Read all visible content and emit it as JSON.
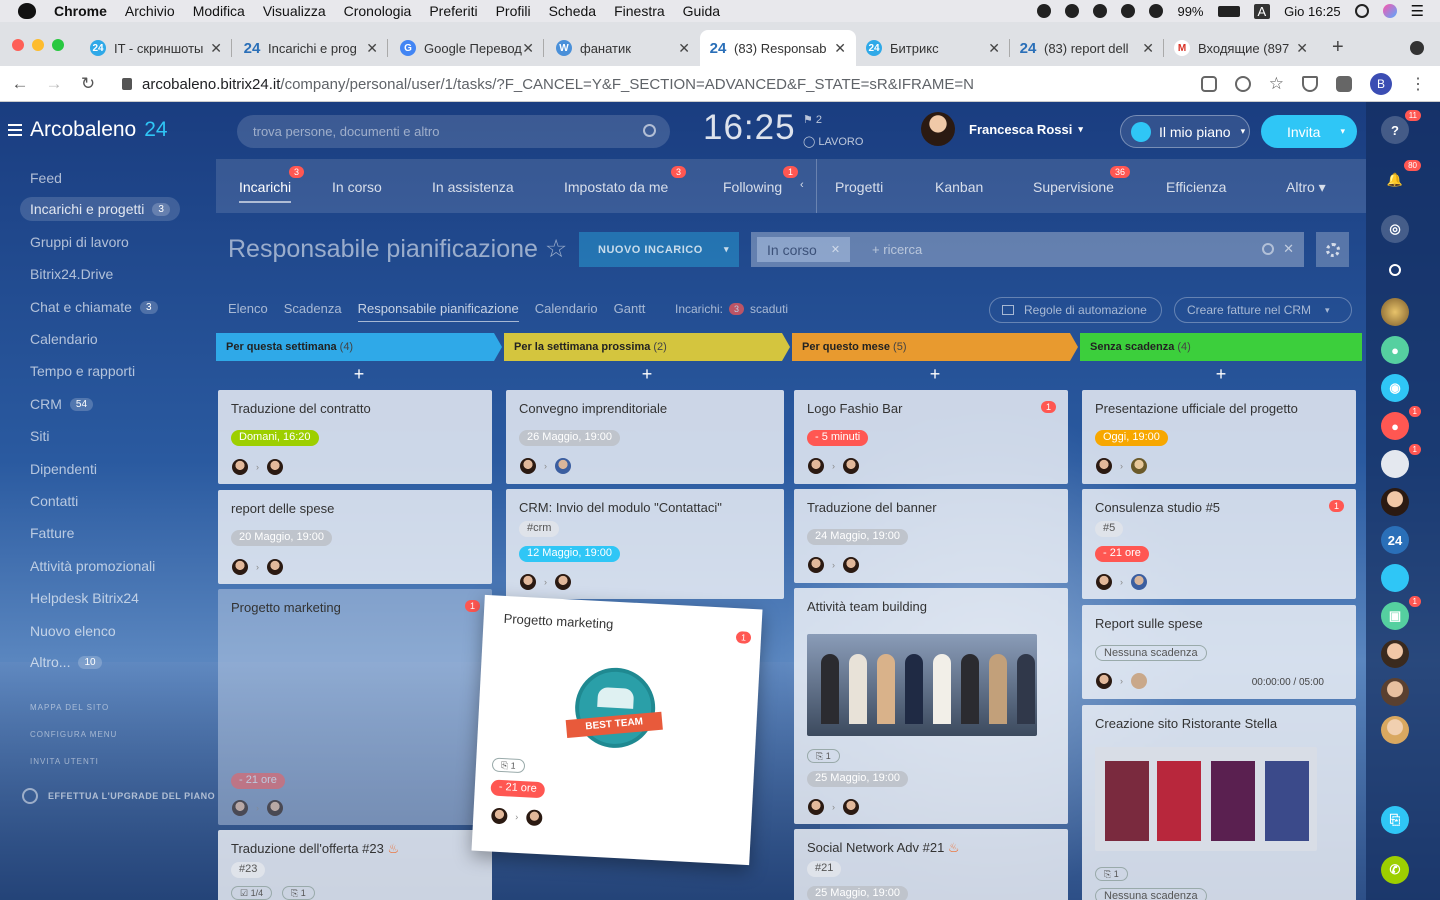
{
  "mac_menu": {
    "app": "Chrome",
    "items": [
      "Archivio",
      "Modifica",
      "Visualizza",
      "Cronologia",
      "Preferiti",
      "Profili",
      "Scheda",
      "Finestra",
      "Guida"
    ],
    "battery": "99%",
    "input_letter": "A",
    "datetime": "Gio 16:25"
  },
  "browser_tabs": [
    {
      "title": "IT - скриншоты",
      "favicon": "24"
    },
    {
      "title": "Incarichi e prog",
      "favicon": "24"
    },
    {
      "title": "Google Перевод",
      "favicon": "G"
    },
    {
      "title": "фанатик",
      "favicon": "W"
    },
    {
      "title": "(83) Responsab",
      "favicon": "24",
      "active": true
    },
    {
      "title": "Битрикс",
      "favicon": "24"
    },
    {
      "title": "(83) report dell",
      "favicon": "24"
    },
    {
      "title": "Входящие (897",
      "favicon": "M"
    }
  ],
  "address": {
    "host": "arcobaleno.bitrix24.it",
    "path": "/company/personal/user/1/tasks/?F_CANCEL=Y&F_SECTION=ADVANCED&F_STATE=sR&IFRAME=N",
    "profile_letter": "B"
  },
  "header": {
    "logo_name": "Arcobaleno",
    "logo_num": "24",
    "search_placeholder": "trova persone, documenti e altro",
    "clock": "16:25",
    "flag_count": "2",
    "work_status": "LAVORO",
    "user_name": "Francesca Rossi",
    "plan_button": "Il mio piano",
    "invite_button": "Invita"
  },
  "left_nav": [
    {
      "label": "Feed"
    },
    {
      "label": "Incarichi e progetti",
      "count": "3",
      "active": true
    },
    {
      "label": "Gruppi di lavoro"
    },
    {
      "label": "Bitrix24.Drive"
    },
    {
      "label": "Chat e chiamate",
      "count": "3"
    },
    {
      "label": "Calendario"
    },
    {
      "label": "Tempo e rapporti"
    },
    {
      "label": "CRM",
      "count": "54"
    },
    {
      "label": "Siti"
    },
    {
      "label": "Dipendenti"
    },
    {
      "label": "Contatti"
    },
    {
      "label": "Fatture"
    },
    {
      "label": "Attività promozionali"
    },
    {
      "label": "Helpdesk Bitrix24"
    },
    {
      "label": "Nuovo elenco"
    },
    {
      "label": "Altro...",
      "count": "10"
    }
  ],
  "left_small": [
    "MAPPA DEL SITO",
    "CONFIGURA MENU",
    "INVITA UTENTI"
  ],
  "upgrade": "EFFETTUA L'UPGRADE DEL PIANO",
  "top_tabs": [
    {
      "label": "Incarichi",
      "count": "3",
      "active": true
    },
    {
      "label": "In corso"
    },
    {
      "label": "In assistenza"
    },
    {
      "label": "Impostato da me",
      "count": "3"
    },
    {
      "label": "Following",
      "count": "1"
    },
    {
      "label": "Progetti"
    },
    {
      "label": "Kanban"
    },
    {
      "label": "Supervisione",
      "count": "36"
    },
    {
      "label": "Efficienza"
    },
    {
      "label": "Altro"
    }
  ],
  "page": {
    "title": "Responsabile pianificazione",
    "new_task": "NUOVO INCARICO",
    "filter_chip": "In corso",
    "filter_placeholder": "+ ricerca"
  },
  "views": [
    "Elenco",
    "Scadenza",
    "Responsabile pianificazione",
    "Calendario",
    "Gantt"
  ],
  "overdue": {
    "label": "Incarichi:",
    "count": "3",
    "suffix": "scaduti"
  },
  "actions": {
    "automation": "Regole di automazione",
    "invoices": "Creare fatture nel CRM"
  },
  "columns": [
    {
      "title": "Per questa settimana",
      "count": "(4)",
      "color": "#2fa9e8"
    },
    {
      "title": "Per la settimana prossima",
      "count": "(2)",
      "color": "#d4c53e"
    },
    {
      "title": "Per questo mese",
      "count": "(5)",
      "color": "#e89a2f"
    },
    {
      "title": "Senza scadenza",
      "count": "(4)",
      "color": "#3ccf3c"
    }
  ],
  "cards": {
    "c1_1": {
      "title": "Traduzione del contratto",
      "date": "Domani, 16:20"
    },
    "c1_2": {
      "title": "report delle spese",
      "date": "20 Maggio, 19:00"
    },
    "c1_3": {
      "title": "Progetto marketing",
      "badge": "1",
      "date": "- 21 ore"
    },
    "c1_4": {
      "title": "Traduzione dell'offerta #23",
      "tag": "#23",
      "checklist": "1/4",
      "files": "1"
    },
    "c2_1": {
      "title": "Convegno imprenditoriale",
      "date": "26 Maggio, 19:00"
    },
    "c2_2": {
      "title": "CRM: Invio del modulo \"Contattaci\"",
      "tag": "#crm",
      "date": "12 Maggio, 19:00"
    },
    "c3_1": {
      "title": "Logo Fashio Bar",
      "badge": "1",
      "date": "- 5 minuti"
    },
    "c3_2": {
      "title": "Traduzione del banner",
      "date": "24 Maggio, 19:00"
    },
    "c3_3": {
      "title": "Attività team building",
      "files": "1",
      "date": "25 Maggio, 19:00"
    },
    "c3_4": {
      "title": "Social Network Adv #21",
      "tag": "#21",
      "date": "25 Maggio, 19:00"
    },
    "c4_1": {
      "title": "Presentazione ufficiale del progetto",
      "date": "Oggi, 19:00"
    },
    "c4_2": {
      "title": "Consulenza studio #5",
      "badge": "1",
      "tag": "#5",
      "date": "- 21 ore"
    },
    "c4_3": {
      "title": "Report sulle spese",
      "date": "Nessuna scadenza",
      "timer": "00:00:00 / 05:00"
    },
    "c4_4": {
      "title": "Creazione sito Ristorante Stella",
      "files": "1",
      "date": "Nessuna scadenza"
    }
  },
  "drag_card": {
    "title": "Progetto marketing",
    "badge": "1",
    "emblem_text": "BEST TEAM",
    "files": "1",
    "date": "- 21 ore"
  },
  "right_bar": [
    {
      "icon": "help-icon",
      "badge": "11"
    },
    {
      "icon": "bell-icon",
      "badge": "80"
    },
    {
      "icon": "chat-icon"
    },
    {
      "icon": "search-icon"
    },
    {
      "icon": "avatar-icon"
    },
    {
      "icon": "user-green-icon"
    },
    {
      "icon": "open-channel-icon"
    },
    {
      "icon": "user-red-icon",
      "badge": "1"
    },
    {
      "icon": "group-icon",
      "badge": "1"
    },
    {
      "icon": "avatar-icon"
    },
    {
      "icon": "bitrix24-icon",
      "label": "24"
    },
    {
      "icon": "group-icon"
    },
    {
      "icon": "lock-icon",
      "badge": "1"
    },
    {
      "icon": "avatar-icon"
    },
    {
      "icon": "avatar-icon"
    },
    {
      "icon": "avatar-icon"
    },
    {
      "icon": "copy-icon"
    },
    {
      "icon": "phone-icon"
    }
  ]
}
